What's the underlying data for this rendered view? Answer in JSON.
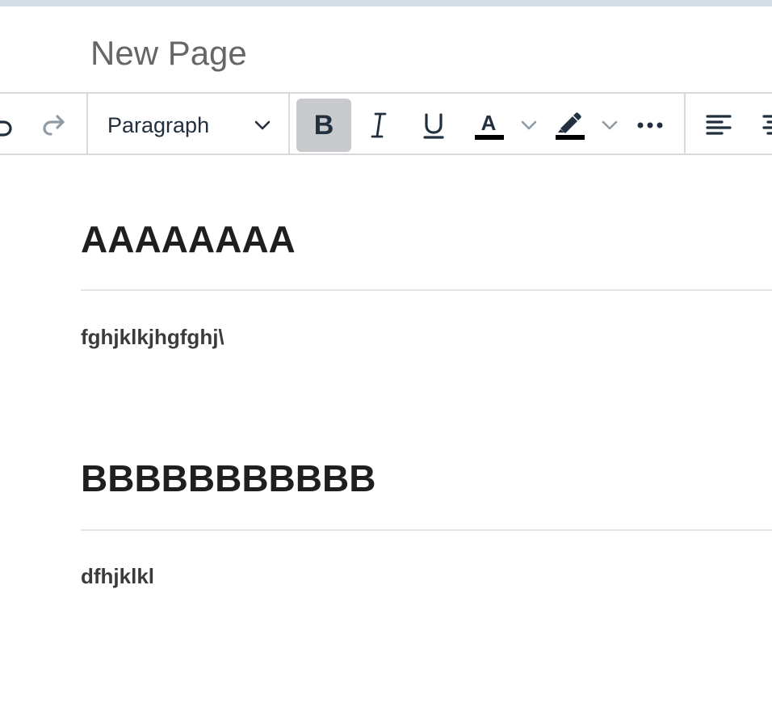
{
  "page": {
    "title": "New Page"
  },
  "toolbar": {
    "block_format": "Paragraph"
  },
  "content": {
    "sections": [
      {
        "heading": "AAAAAAAA",
        "paragraph": "fghjklkjhgfghj\\"
      },
      {
        "heading": "BBBBBBBBBBB",
        "paragraph": "dfhjklkl"
      }
    ]
  },
  "colors": {
    "accent_strip": "#d5dee6",
    "active_button": "#c8cacd",
    "icon": "#222f3e",
    "icon_disabled": "#8f9aa3",
    "border": "#d9d9d9"
  }
}
